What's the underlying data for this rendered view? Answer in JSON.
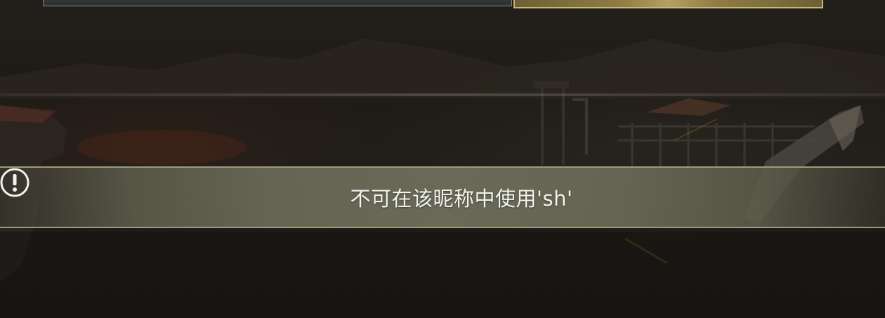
{
  "toast": {
    "message": "不可在该昵称中使用'sh'",
    "icon": "exclamation-circle-icon"
  },
  "colors": {
    "toast_text": "#f2f2ee",
    "toast_border": "#9c9a7d",
    "confirm_button_gold": "#b4a168",
    "background": "#1a1712"
  }
}
